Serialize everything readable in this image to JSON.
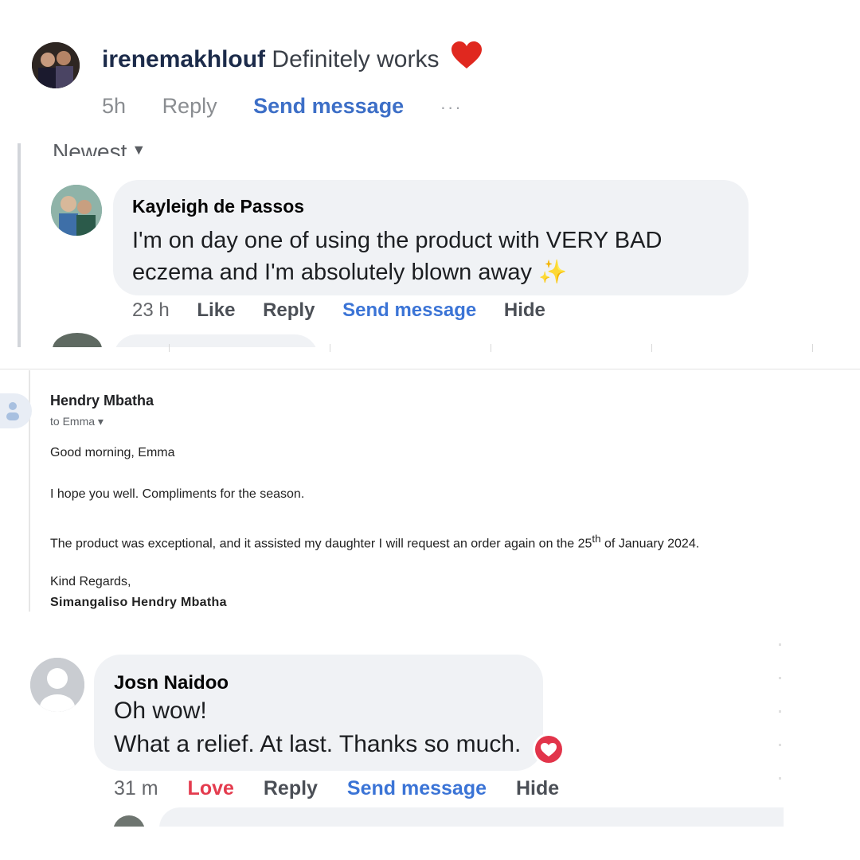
{
  "comment1": {
    "username": "irenemakhlouf",
    "text": "Definitely works",
    "reaction_icon": "red-heart-emoji",
    "time": "5h",
    "reply": "Reply",
    "send_message": "Send message",
    "more": "···"
  },
  "thread": {
    "sort_label": "Newest",
    "comment": {
      "author": "Kayleigh de Passos",
      "text": "I'm on day one of using the product with VERY BAD eczema and I'm absolutely blown away",
      "emoji": "✨",
      "time": "23 h",
      "like": "Like",
      "reply": "Reply",
      "send_message": "Send message",
      "hide": "Hide"
    }
  },
  "email": {
    "sender": "Hendry Mbatha",
    "to": "to Emma",
    "greeting": "Good morning, Emma",
    "line1": "I hope you well. Compliments for the season.",
    "line2_before": "The product was exceptional, and it assisted my daughter I will request an order again on the 25",
    "line2_sup": "th",
    "line2_after": " of January 2024.",
    "closing": "Kind Regards,",
    "signature": "Simangaliso Hendry Mbatha"
  },
  "comment3": {
    "author": "Josn Naidoo",
    "line1": "Oh wow!",
    "line2": "What a relief. At last. Thanks so much.",
    "reaction_icon": "love-reaction-icon",
    "time": "31 m",
    "love": "Love",
    "reply": "Reply",
    "send_message": "Send message",
    "hide": "Hide"
  },
  "colors": {
    "bubble": "#f0f2f5",
    "link_blue": "#3b74d6",
    "love_red": "#e43b4e",
    "heart_red": "#e0281f"
  }
}
